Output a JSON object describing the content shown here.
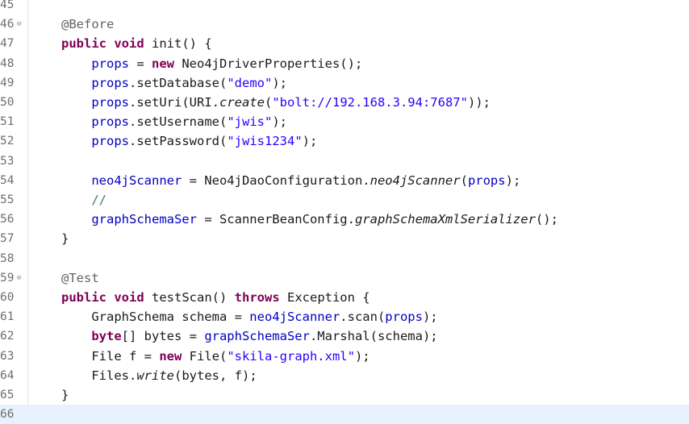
{
  "editor": {
    "lines": [
      {
        "num": "45",
        "fold": "",
        "tokens": []
      },
      {
        "num": "46",
        "fold": "⊖",
        "tokens": [
          {
            "t": "@Before",
            "c": "ann"
          }
        ]
      },
      {
        "num": "47",
        "fold": "",
        "tokens": [
          {
            "t": "public",
            "c": "kw"
          },
          {
            "t": " "
          },
          {
            "t": "void",
            "c": "kw"
          },
          {
            "t": " init() {"
          }
        ]
      },
      {
        "num": "48",
        "fold": "",
        "tokens": [
          {
            "t": "    "
          },
          {
            "t": "props",
            "c": "fld"
          },
          {
            "t": " = "
          },
          {
            "t": "new",
            "c": "kw"
          },
          {
            "t": " Neo4jDriverProperties();"
          }
        ]
      },
      {
        "num": "49",
        "fold": "",
        "tokens": [
          {
            "t": "    "
          },
          {
            "t": "props",
            "c": "fld"
          },
          {
            "t": ".setDatabase("
          },
          {
            "t": "\"demo\"",
            "c": "str"
          },
          {
            "t": ");"
          }
        ]
      },
      {
        "num": "50",
        "fold": "",
        "tokens": [
          {
            "t": "    "
          },
          {
            "t": "props",
            "c": "fld"
          },
          {
            "t": ".setUri(URI."
          },
          {
            "t": "create",
            "c": "it"
          },
          {
            "t": "("
          },
          {
            "t": "\"bolt://192.168.3.94:7687\"",
            "c": "str"
          },
          {
            "t": "));"
          }
        ]
      },
      {
        "num": "51",
        "fold": "",
        "tokens": [
          {
            "t": "    "
          },
          {
            "t": "props",
            "c": "fld"
          },
          {
            "t": ".setUsername("
          },
          {
            "t": "\"jwis\"",
            "c": "str"
          },
          {
            "t": ");"
          }
        ]
      },
      {
        "num": "52",
        "fold": "",
        "tokens": [
          {
            "t": "    "
          },
          {
            "t": "props",
            "c": "fld"
          },
          {
            "t": ".setPassword("
          },
          {
            "t": "\"jwis1234\"",
            "c": "str"
          },
          {
            "t": ");"
          }
        ]
      },
      {
        "num": "53",
        "fold": "",
        "tokens": []
      },
      {
        "num": "54",
        "fold": "",
        "tokens": [
          {
            "t": "    "
          },
          {
            "t": "neo4jScanner",
            "c": "fld"
          },
          {
            "t": " = Neo4jDaoConfiguration."
          },
          {
            "t": "neo4jScanner",
            "c": "it"
          },
          {
            "t": "("
          },
          {
            "t": "props",
            "c": "fld"
          },
          {
            "t": ");"
          }
        ]
      },
      {
        "num": "55",
        "fold": "",
        "tokens": [
          {
            "t": "    "
          },
          {
            "t": "//",
            "c": "cmt"
          }
        ]
      },
      {
        "num": "56",
        "fold": "",
        "tokens": [
          {
            "t": "    "
          },
          {
            "t": "graphSchemaSer",
            "c": "fld"
          },
          {
            "t": " = ScannerBeanConfig."
          },
          {
            "t": "graphSchemaXmlSerializer",
            "c": "it"
          },
          {
            "t": "();"
          }
        ]
      },
      {
        "num": "57",
        "fold": "",
        "tokens": [
          {
            "t": "}"
          }
        ]
      },
      {
        "num": "58",
        "fold": "",
        "tokens": []
      },
      {
        "num": "59",
        "fold": "⊖",
        "tokens": [
          {
            "t": "@Test",
            "c": "ann"
          }
        ]
      },
      {
        "num": "60",
        "fold": "",
        "tokens": [
          {
            "t": "public",
            "c": "kw"
          },
          {
            "t": " "
          },
          {
            "t": "void",
            "c": "kw"
          },
          {
            "t": " testScan() "
          },
          {
            "t": "throws",
            "c": "kw"
          },
          {
            "t": " Exception {"
          }
        ]
      },
      {
        "num": "61",
        "fold": "",
        "tokens": [
          {
            "t": "    GraphSchema schema = "
          },
          {
            "t": "neo4jScanner",
            "c": "fld"
          },
          {
            "t": ".scan("
          },
          {
            "t": "props",
            "c": "fld"
          },
          {
            "t": ");"
          }
        ]
      },
      {
        "num": "62",
        "fold": "",
        "tokens": [
          {
            "t": "    "
          },
          {
            "t": "byte",
            "c": "kw"
          },
          {
            "t": "[] bytes = "
          },
          {
            "t": "graphSchemaSer",
            "c": "fld"
          },
          {
            "t": ".Marshal(schema);"
          }
        ]
      },
      {
        "num": "63",
        "fold": "",
        "tokens": [
          {
            "t": "    File f = "
          },
          {
            "t": "new",
            "c": "kw"
          },
          {
            "t": " File("
          },
          {
            "t": "\"skila-graph.xml\"",
            "c": "str"
          },
          {
            "t": ");"
          }
        ]
      },
      {
        "num": "64",
        "fold": "",
        "tokens": [
          {
            "t": "    Files."
          },
          {
            "t": "write",
            "c": "it"
          },
          {
            "t": "(bytes, f);"
          }
        ]
      },
      {
        "num": "65",
        "fold": "",
        "tokens": [
          {
            "t": "}"
          }
        ]
      },
      {
        "num": "66",
        "fold": "",
        "tokens": []
      }
    ]
  }
}
